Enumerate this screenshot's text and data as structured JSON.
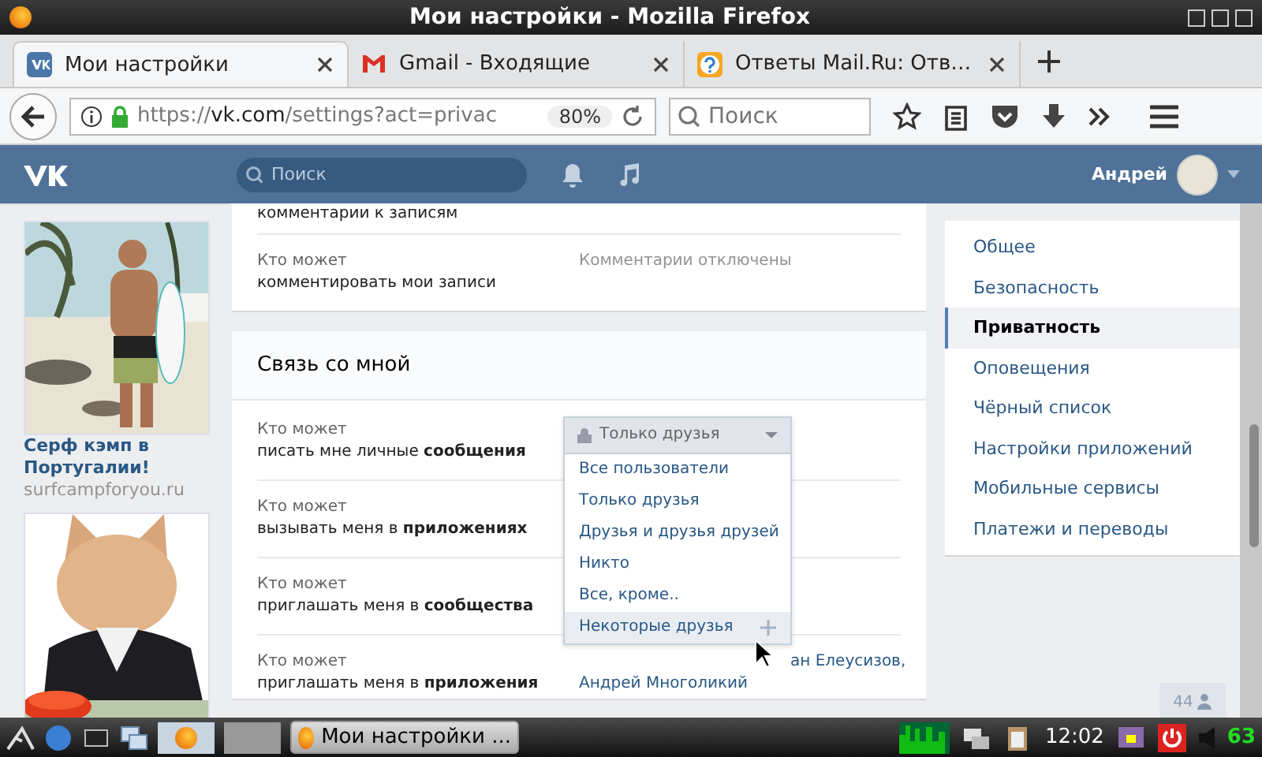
{
  "window": {
    "title": "Мои настройки - Mozilla Firefox"
  },
  "tabs": [
    {
      "label": "Мои настройки",
      "selected": true
    },
    {
      "label": "Gmail - Входящие",
      "selected": false
    },
    {
      "label": "Ответы Mail.Ru: Отв…",
      "selected": false
    }
  ],
  "address": {
    "scheme": "https://",
    "host": "vk.com",
    "path": "/settings?act=privac",
    "zoom": "80%"
  },
  "browser_search": {
    "placeholder": "Поиск"
  },
  "header": {
    "search_placeholder": "Поиск",
    "user": "Андрей"
  },
  "ads": [
    {
      "title": "Серф кэмп в Португалии!",
      "domain": "surfcampforyou.ru",
      "kind": "beach"
    },
    {
      "kind": "cat"
    }
  ],
  "sections": [
    {
      "rows": [
        {
          "label": "комментарии к записям",
          "kind": "tail"
        },
        {
          "question": "Кто может",
          "label": "комментировать мои записи",
          "value": "Комментарии отключены",
          "kind": "row"
        }
      ]
    },
    {
      "title": "Связь со мной",
      "rows": [
        {
          "question": "Кто может",
          "label": "писать мне личные **сообщения**",
          "kind": "row"
        },
        {
          "question": "Кто может",
          "label": "вызывать меня в **приложениях**",
          "kind": "row"
        },
        {
          "question": "Кто может",
          "label": "приглашать меня в **сообщества**",
          "kind": "row"
        },
        {
          "question": "Кто может",
          "label": "приглашать меня в **приложения**",
          "value_lines": [
            "ан Елеусизов,",
            "Андрей Многоликий"
          ],
          "kind": "row"
        }
      ]
    }
  ],
  "dropdown": {
    "current": "Только друзья",
    "options": [
      {
        "label": "Все пользователи",
        "highlighted": false
      },
      {
        "label": "Только друзья",
        "highlighted": false
      },
      {
        "label": "Друзья и друзья друзей",
        "highlighted": false
      },
      {
        "label": "Никто",
        "highlighted": false
      },
      {
        "label": "Все, кроме..",
        "highlighted": false
      },
      {
        "label": "Некоторые друзья",
        "highlighted": true
      }
    ]
  },
  "menu": [
    {
      "label": "Общее",
      "selected": false
    },
    {
      "label": "Безопасность",
      "selected": false
    },
    {
      "label": "Приватность",
      "selected": true
    },
    {
      "label": "Оповещения",
      "selected": false
    },
    {
      "label": "Чёрный список",
      "selected": false
    },
    {
      "label": "Настройки приложений",
      "selected": false
    },
    {
      "label": "Мобильные сервисы",
      "selected": false
    },
    {
      "label": "Платежи и переводы",
      "selected": false
    }
  ],
  "online_count": "44",
  "taskbar": {
    "window_button": "Мои настройки ...",
    "clock": "12:02",
    "battery": "63"
  }
}
